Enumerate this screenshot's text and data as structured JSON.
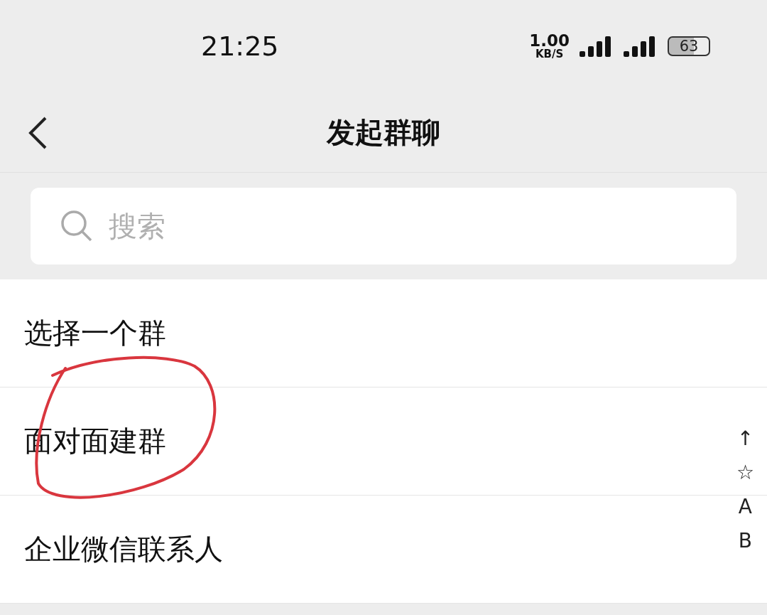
{
  "status_bar": {
    "time": "21:25",
    "speed_value": "1.00",
    "speed_unit": "KB/S",
    "battery": "63"
  },
  "header": {
    "title": "发起群聊"
  },
  "search": {
    "placeholder": "搜索"
  },
  "items": [
    {
      "label": "选择一个群"
    },
    {
      "label": "面对面建群"
    },
    {
      "label": "企业微信联系人"
    }
  ],
  "index": [
    "↑",
    "☆",
    "A",
    "B"
  ]
}
